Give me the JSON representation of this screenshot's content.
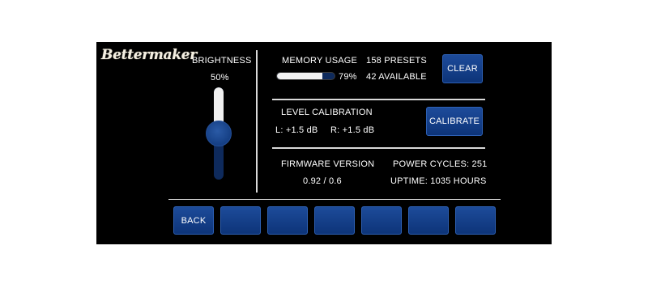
{
  "brand": {
    "logo_text": "Bettermaker"
  },
  "brightness": {
    "label": "BRIGHTNESS",
    "value_text": "50%",
    "level": 0.5
  },
  "memory": {
    "label": "MEMORY USAGE",
    "percent_text": "79%",
    "usage": 0.79,
    "presets": "158 PRESETS",
    "available": "42 AVAILABLE",
    "clear_label": "CLEAR"
  },
  "calibration": {
    "label": "LEVEL CALIBRATION",
    "left": "L: +1.5 dB",
    "right": "R: +1.5 dB",
    "calibrate_label": "CALIBRATE"
  },
  "firmware": {
    "label": "FIRMWARE VERSION",
    "value": "0.92 / 0.6",
    "power_cycles": "POWER CYCLES: 251",
    "uptime": "UPTIME: 1035 HOURS"
  },
  "bottom_bar": {
    "back_label": "BACK",
    "buttons": [
      "",
      "",
      "",
      "",
      "",
      ""
    ]
  },
  "colors": {
    "screen_bg": "#000000",
    "button_blue": "#123d86",
    "track_dark": "#0e2a5c",
    "fill_light": "#f0f0f0"
  }
}
